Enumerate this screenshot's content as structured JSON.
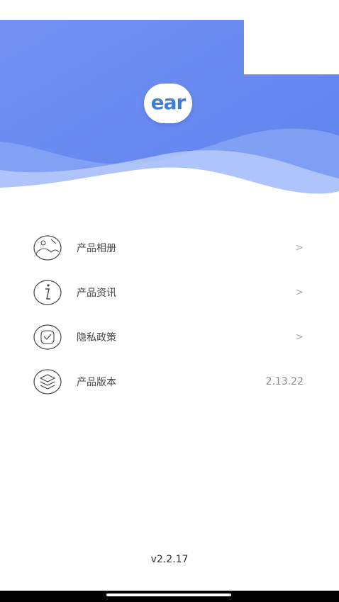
{
  "header": {
    "logo_text": "ear",
    "colors": {
      "banner_top": "#6f8ef2",
      "banner_bottom": "#5c82ef",
      "wave_light": "#c9d8fb"
    }
  },
  "menu": {
    "items": [
      {
        "label": "产品相册",
        "icon": "photo-album-icon",
        "trailing": ">"
      },
      {
        "label": "产品资讯",
        "icon": "info-icon",
        "trailing": ">"
      },
      {
        "label": "隐私政策",
        "icon": "shield-check-icon",
        "trailing": ">"
      },
      {
        "label": "产品版本",
        "icon": "layers-icon",
        "value": "2.13.22"
      }
    ]
  },
  "footer": {
    "app_version": "v2.2.17"
  }
}
